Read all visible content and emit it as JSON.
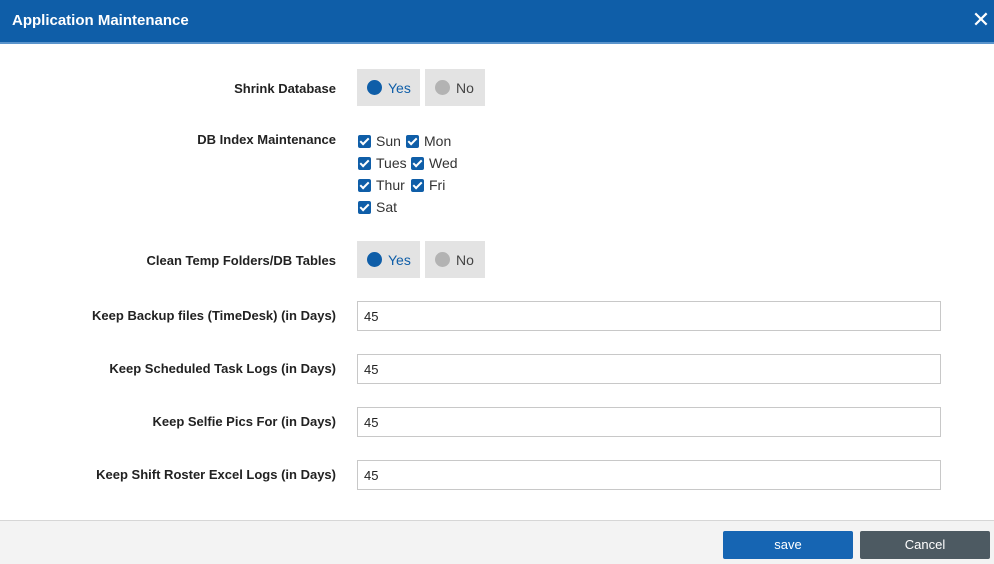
{
  "dialog": {
    "title": "Application Maintenance",
    "close_icon": "close-icon",
    "close_glyph": "✕"
  },
  "shrink_database": {
    "label": "Shrink Database",
    "yes_label": "Yes",
    "no_label": "No",
    "selected": "Yes"
  },
  "db_index": {
    "label": "DB Index Maintenance",
    "days": [
      {
        "label": "Sun",
        "checked": true
      },
      {
        "label": "Mon",
        "checked": true
      },
      {
        "label": "Tues",
        "checked": true
      },
      {
        "label": "Wed",
        "checked": true
      },
      {
        "label": "Thur",
        "checked": true
      },
      {
        "label": "Fri",
        "checked": true
      },
      {
        "label": "Sat",
        "checked": true
      }
    ]
  },
  "clean_temp": {
    "label": "Clean Temp Folders/DB Tables",
    "yes_label": "Yes",
    "no_label": "No",
    "selected": "Yes"
  },
  "fields": {
    "backup": {
      "label": "Keep Backup files (TimeDesk) (in Days)",
      "value": "45"
    },
    "task_logs": {
      "label": "Keep Scheduled Task Logs (in Days)",
      "value": "45"
    },
    "selfie": {
      "label": "Keep Selfie Pics For (in Days)",
      "value": "45"
    },
    "roster": {
      "label": "Keep Shift Roster Excel Logs (in Days)",
      "value": "45"
    }
  },
  "footer": {
    "save_label": "save",
    "cancel_label": "Cancel"
  },
  "colors": {
    "header": "#0f5ea8",
    "accent": "#0f5ea8",
    "save_button": "#1665b3",
    "cancel_button": "#4d5a62"
  }
}
